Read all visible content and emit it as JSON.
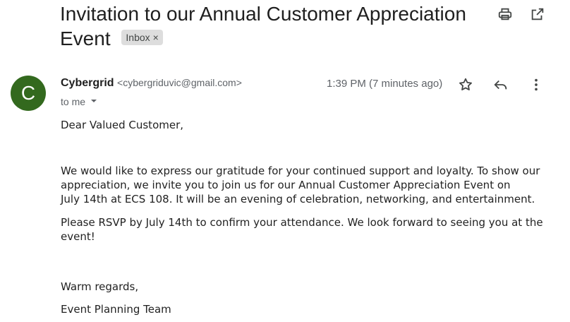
{
  "email": {
    "subject": "Invitation to our Annual Customer Appreciation Event",
    "label": "Inbox",
    "label_remove": "×",
    "sender_name": "Cybergrid",
    "sender_email": "<cybergriduvic@gmail.com>",
    "avatar_letter": "C",
    "recipient": "to me",
    "time": "1:39 PM (7 minutes ago)",
    "body": {
      "greeting": "Dear Valued Customer,",
      "paragraph1_line1": "We would like to express our gratitude for your continued support and loyalty. To show our",
      "paragraph1_line2": "appreciation, we invite you to join us for our Annual Customer Appreciation Event on",
      "paragraph1_line3": "July 14th at ECS 108. It will be an evening of celebration, networking, and entertainment.",
      "paragraph2": "Please RSVP by July 14th to confirm your attendance. We look forward to seeing you at the event!",
      "closing": "Warm regards,",
      "signature": "Event Planning Team"
    }
  },
  "colors": {
    "avatar": "#33691e",
    "chip_bg": "#dddddd",
    "icon": "#444746"
  },
  "icons": [
    "print-icon",
    "open-in-new-window-icon",
    "chevron-down-icon",
    "star-icon",
    "reply-icon",
    "more-vert-icon"
  ]
}
